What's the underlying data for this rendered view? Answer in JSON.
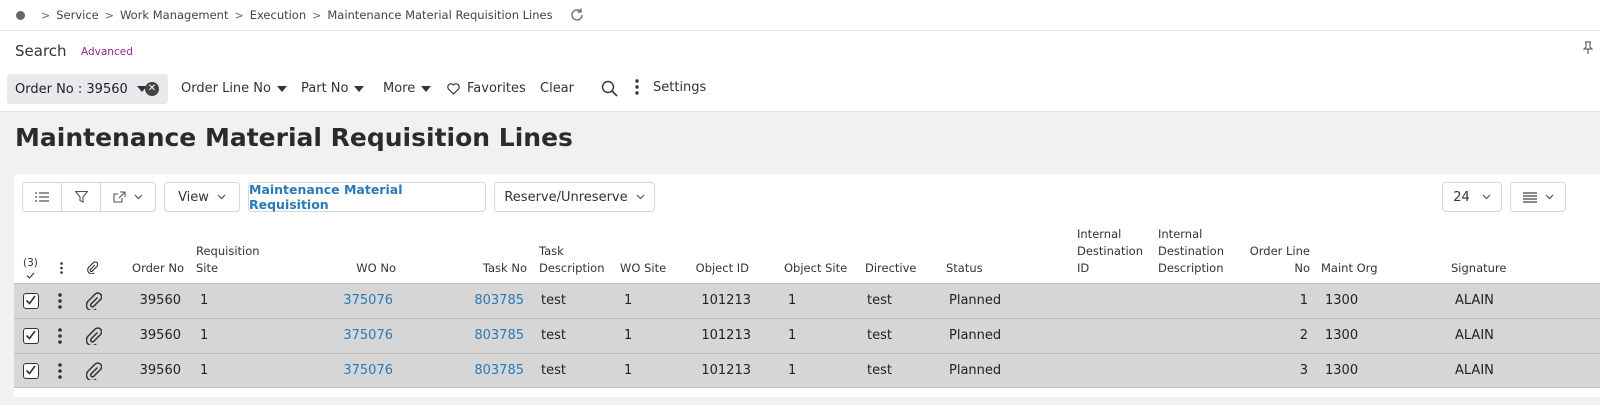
{
  "breadcrumb": {
    "items": [
      "Service",
      "Work Management",
      "Execution",
      "Maintenance Material Requisition Lines"
    ]
  },
  "search": {
    "title": "Search",
    "advanced_label": "Advanced",
    "chip_label": "Order No : 39560",
    "filters": {
      "order_line_no": "Order Line No",
      "part_no": "Part No",
      "more": "More",
      "favorites": "Favorites",
      "clear": "Clear",
      "settings": "Settings"
    }
  },
  "page": {
    "title": "Maintenance Material Requisition Lines"
  },
  "toolbar": {
    "view_label": "View",
    "mmr_label": "Maintenance Material Requisition",
    "reserve_label": "Reserve/Unreserve",
    "page_size": "24"
  },
  "table": {
    "selection_count": "(3)",
    "headers": {
      "order_no": "Order No",
      "req_site_1": "Requisition",
      "req_site_2": "Site",
      "wo_no": "WO No",
      "task_no": "Task No",
      "task_desc_1": "Task",
      "task_desc_2": "Description",
      "wo_site": "WO Site",
      "object_id": "Object ID",
      "object_site": "Object Site",
      "directive": "Directive",
      "status": "Status",
      "int_dest_id_1": "Internal",
      "int_dest_id_2": "Destination",
      "int_dest_id_3": "ID",
      "int_dest_desc_1": "Internal",
      "int_dest_desc_2": "Destination",
      "int_dest_desc_3": "Description",
      "order_line_no_1": "Order Line",
      "order_line_no_2": "No",
      "maint_org": "Maint Org",
      "signature": "Signature"
    },
    "rows": [
      {
        "order_no": "39560",
        "req_site": "1",
        "wo_no": "375076",
        "task_no": "803785",
        "task_desc": "test",
        "wo_site": "1",
        "object_id": "101213",
        "object_site": "1",
        "directive": "test",
        "status": "Planned",
        "order_line_no": "1",
        "maint_org": "1300",
        "signature": "ALAIN"
      },
      {
        "order_no": "39560",
        "req_site": "1",
        "wo_no": "375076",
        "task_no": "803785",
        "task_desc": "test",
        "wo_site": "1",
        "object_id": "101213",
        "object_site": "1",
        "directive": "test",
        "status": "Planned",
        "order_line_no": "2",
        "maint_org": "1300",
        "signature": "ALAIN"
      },
      {
        "order_no": "39560",
        "req_site": "1",
        "wo_no": "375076",
        "task_no": "803785",
        "task_desc": "test",
        "wo_site": "1",
        "object_id": "101213",
        "object_site": "1",
        "directive": "test",
        "status": "Planned",
        "order_line_no": "3",
        "maint_org": "1300",
        "signature": "ALAIN"
      }
    ]
  },
  "colors": {
    "link": "#2a7ab6",
    "advanced": "#8a2a8a",
    "row_bg": "#d6d6d6"
  }
}
